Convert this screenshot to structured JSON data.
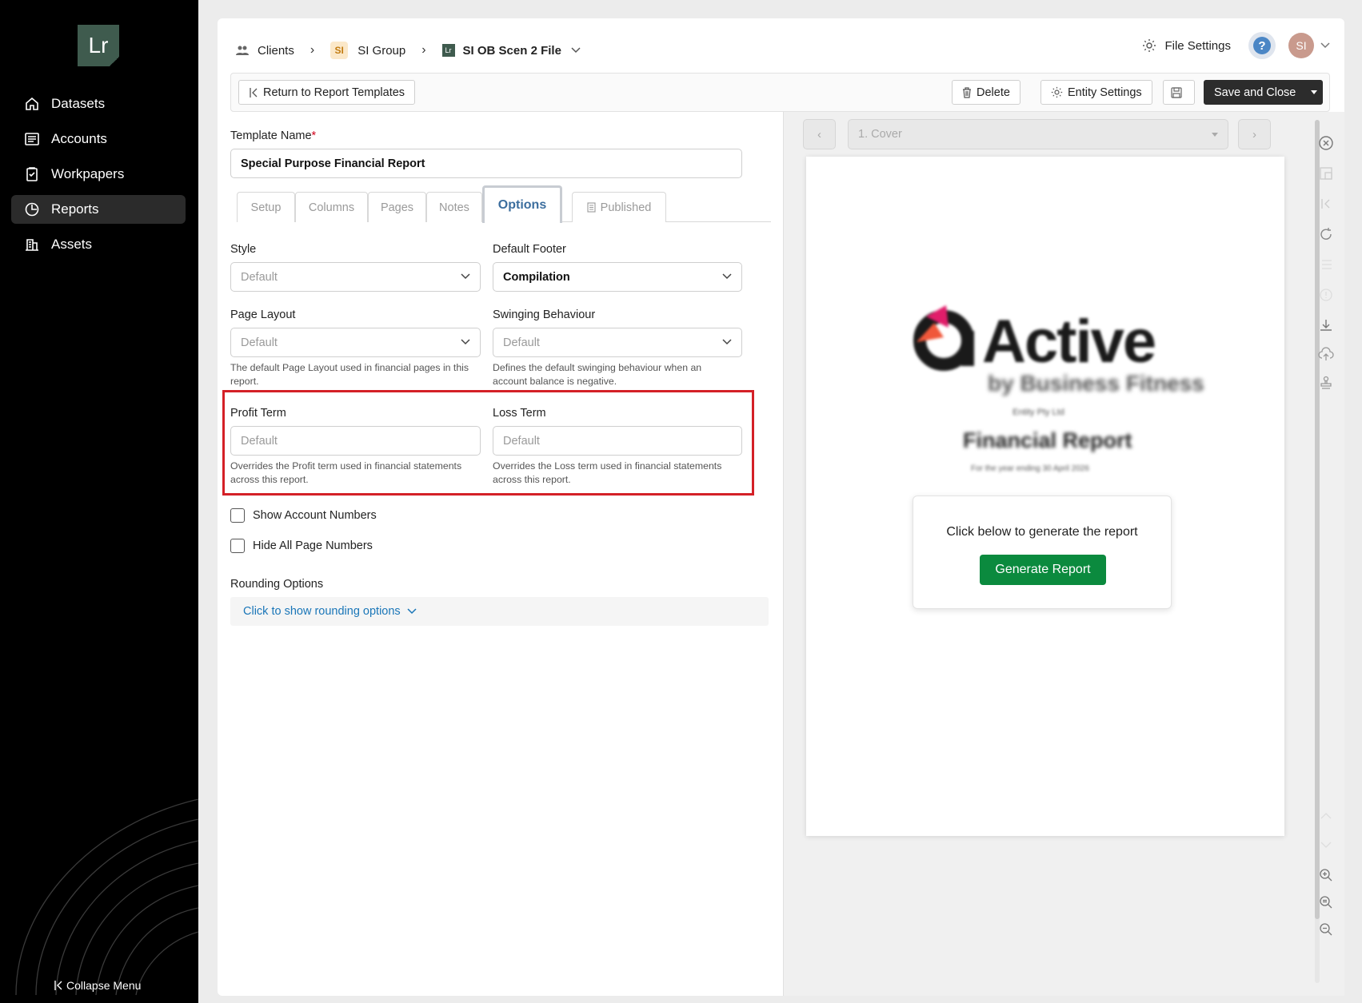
{
  "sidebar": {
    "logo": "Lr",
    "items": [
      {
        "label": "Datasets",
        "icon": "home-icon"
      },
      {
        "label": "Accounts",
        "icon": "list-icon"
      },
      {
        "label": "Workpapers",
        "icon": "clipboard-icon"
      },
      {
        "label": "Reports",
        "icon": "clock-icon",
        "active": true
      },
      {
        "label": "Assets",
        "icon": "building-icon"
      }
    ],
    "collapse_label": "Collapse Menu"
  },
  "breadcrumb": {
    "clients": "Clients",
    "group": "SI Group",
    "group_badge": "SI",
    "file": "SI OB Scen 2 File",
    "file_badge": "Lr"
  },
  "topbar": {
    "file_settings": "File Settings",
    "help": "?",
    "avatar": "SI"
  },
  "toolbar": {
    "return_label": "Return to Report Templates",
    "delete_label": "Delete",
    "entity_settings_label": "Entity Settings",
    "save_close_label": "Save and Close"
  },
  "form": {
    "template_name_label": "Template Name",
    "template_name_required": "*",
    "template_name_value": "Special Purpose Financial Report",
    "tabs": [
      "Setup",
      "Columns",
      "Pages",
      "Notes",
      "Options",
      "Published"
    ],
    "active_tab": "Options",
    "style_label": "Style",
    "style_value": "Default",
    "default_footer_label": "Default Footer",
    "default_footer_value": "Compilation",
    "page_layout_label": "Page Layout",
    "page_layout_value": "Default",
    "page_layout_help": "The default Page Layout used in financial pages in this report.",
    "swinging_label": "Swinging Behaviour",
    "swinging_value": "Default",
    "swinging_help": "Defines the default swinging behaviour when an account balance is negative.",
    "profit_term_label": "Profit Term",
    "profit_term_placeholder": "Default",
    "profit_term_help": "Overrides the Profit term used in financial statements across this report.",
    "loss_term_label": "Loss Term",
    "loss_term_placeholder": "Default",
    "loss_term_help": "Overrides the Loss term used in financial statements across this report.",
    "show_account_numbers": "Show Account Numbers",
    "hide_page_numbers": "Hide All Page Numbers",
    "rounding_label": "Rounding Options",
    "rounding_link": "Click to show rounding options"
  },
  "preview": {
    "page_select": "1. Cover",
    "brand_name": "Active",
    "brand_sub": "by Business Fitness",
    "entity": "Entity Pty Ltd",
    "report_title": "Financial Report",
    "report_period": "For the year ending 30 April 2026",
    "generate_prompt": "Click below to generate the report",
    "generate_button": "Generate Report"
  },
  "colors": {
    "sidebar_bg": "#000000",
    "logo_bg": "#3f5b4e",
    "highlight": "#d42027",
    "generate_btn": "#0b8a3e",
    "link": "#1a76b8",
    "active_tab": "#3c6e9e"
  }
}
